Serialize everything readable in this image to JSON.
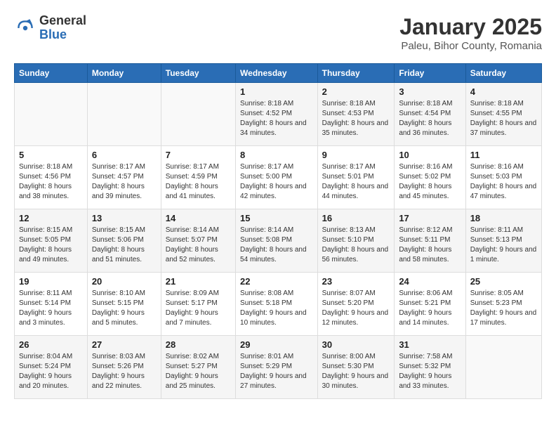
{
  "logo": {
    "general": "General",
    "blue": "Blue"
  },
  "title": "January 2025",
  "subtitle": "Paleu, Bihor County, Romania",
  "weekdays": [
    "Sunday",
    "Monday",
    "Tuesday",
    "Wednesday",
    "Thursday",
    "Friday",
    "Saturday"
  ],
  "weeks": [
    [
      {
        "day": "",
        "sunrise": "",
        "sunset": "",
        "daylight": ""
      },
      {
        "day": "",
        "sunrise": "",
        "sunset": "",
        "daylight": ""
      },
      {
        "day": "",
        "sunrise": "",
        "sunset": "",
        "daylight": ""
      },
      {
        "day": "1",
        "sunrise": "Sunrise: 8:18 AM",
        "sunset": "Sunset: 4:52 PM",
        "daylight": "Daylight: 8 hours and 34 minutes."
      },
      {
        "day": "2",
        "sunrise": "Sunrise: 8:18 AM",
        "sunset": "Sunset: 4:53 PM",
        "daylight": "Daylight: 8 hours and 35 minutes."
      },
      {
        "day": "3",
        "sunrise": "Sunrise: 8:18 AM",
        "sunset": "Sunset: 4:54 PM",
        "daylight": "Daylight: 8 hours and 36 minutes."
      },
      {
        "day": "4",
        "sunrise": "Sunrise: 8:18 AM",
        "sunset": "Sunset: 4:55 PM",
        "daylight": "Daylight: 8 hours and 37 minutes."
      }
    ],
    [
      {
        "day": "5",
        "sunrise": "Sunrise: 8:18 AM",
        "sunset": "Sunset: 4:56 PM",
        "daylight": "Daylight: 8 hours and 38 minutes."
      },
      {
        "day": "6",
        "sunrise": "Sunrise: 8:17 AM",
        "sunset": "Sunset: 4:57 PM",
        "daylight": "Daylight: 8 hours and 39 minutes."
      },
      {
        "day": "7",
        "sunrise": "Sunrise: 8:17 AM",
        "sunset": "Sunset: 4:59 PM",
        "daylight": "Daylight: 8 hours and 41 minutes."
      },
      {
        "day": "8",
        "sunrise": "Sunrise: 8:17 AM",
        "sunset": "Sunset: 5:00 PM",
        "daylight": "Daylight: 8 hours and 42 minutes."
      },
      {
        "day": "9",
        "sunrise": "Sunrise: 8:17 AM",
        "sunset": "Sunset: 5:01 PM",
        "daylight": "Daylight: 8 hours and 44 minutes."
      },
      {
        "day": "10",
        "sunrise": "Sunrise: 8:16 AM",
        "sunset": "Sunset: 5:02 PM",
        "daylight": "Daylight: 8 hours and 45 minutes."
      },
      {
        "day": "11",
        "sunrise": "Sunrise: 8:16 AM",
        "sunset": "Sunset: 5:03 PM",
        "daylight": "Daylight: 8 hours and 47 minutes."
      }
    ],
    [
      {
        "day": "12",
        "sunrise": "Sunrise: 8:15 AM",
        "sunset": "Sunset: 5:05 PM",
        "daylight": "Daylight: 8 hours and 49 minutes."
      },
      {
        "day": "13",
        "sunrise": "Sunrise: 8:15 AM",
        "sunset": "Sunset: 5:06 PM",
        "daylight": "Daylight: 8 hours and 51 minutes."
      },
      {
        "day": "14",
        "sunrise": "Sunrise: 8:14 AM",
        "sunset": "Sunset: 5:07 PM",
        "daylight": "Daylight: 8 hours and 52 minutes."
      },
      {
        "day": "15",
        "sunrise": "Sunrise: 8:14 AM",
        "sunset": "Sunset: 5:08 PM",
        "daylight": "Daylight: 8 hours and 54 minutes."
      },
      {
        "day": "16",
        "sunrise": "Sunrise: 8:13 AM",
        "sunset": "Sunset: 5:10 PM",
        "daylight": "Daylight: 8 hours and 56 minutes."
      },
      {
        "day": "17",
        "sunrise": "Sunrise: 8:12 AM",
        "sunset": "Sunset: 5:11 PM",
        "daylight": "Daylight: 8 hours and 58 minutes."
      },
      {
        "day": "18",
        "sunrise": "Sunrise: 8:11 AM",
        "sunset": "Sunset: 5:13 PM",
        "daylight": "Daylight: 9 hours and 1 minute."
      }
    ],
    [
      {
        "day": "19",
        "sunrise": "Sunrise: 8:11 AM",
        "sunset": "Sunset: 5:14 PM",
        "daylight": "Daylight: 9 hours and 3 minutes."
      },
      {
        "day": "20",
        "sunrise": "Sunrise: 8:10 AM",
        "sunset": "Sunset: 5:15 PM",
        "daylight": "Daylight: 9 hours and 5 minutes."
      },
      {
        "day": "21",
        "sunrise": "Sunrise: 8:09 AM",
        "sunset": "Sunset: 5:17 PM",
        "daylight": "Daylight: 9 hours and 7 minutes."
      },
      {
        "day": "22",
        "sunrise": "Sunrise: 8:08 AM",
        "sunset": "Sunset: 5:18 PM",
        "daylight": "Daylight: 9 hours and 10 minutes."
      },
      {
        "day": "23",
        "sunrise": "Sunrise: 8:07 AM",
        "sunset": "Sunset: 5:20 PM",
        "daylight": "Daylight: 9 hours and 12 minutes."
      },
      {
        "day": "24",
        "sunrise": "Sunrise: 8:06 AM",
        "sunset": "Sunset: 5:21 PM",
        "daylight": "Daylight: 9 hours and 14 minutes."
      },
      {
        "day": "25",
        "sunrise": "Sunrise: 8:05 AM",
        "sunset": "Sunset: 5:23 PM",
        "daylight": "Daylight: 9 hours and 17 minutes."
      }
    ],
    [
      {
        "day": "26",
        "sunrise": "Sunrise: 8:04 AM",
        "sunset": "Sunset: 5:24 PM",
        "daylight": "Daylight: 9 hours and 20 minutes."
      },
      {
        "day": "27",
        "sunrise": "Sunrise: 8:03 AM",
        "sunset": "Sunset: 5:26 PM",
        "daylight": "Daylight: 9 hours and 22 minutes."
      },
      {
        "day": "28",
        "sunrise": "Sunrise: 8:02 AM",
        "sunset": "Sunset: 5:27 PM",
        "daylight": "Daylight: 9 hours and 25 minutes."
      },
      {
        "day": "29",
        "sunrise": "Sunrise: 8:01 AM",
        "sunset": "Sunset: 5:29 PM",
        "daylight": "Daylight: 9 hours and 27 minutes."
      },
      {
        "day": "30",
        "sunrise": "Sunrise: 8:00 AM",
        "sunset": "Sunset: 5:30 PM",
        "daylight": "Daylight: 9 hours and 30 minutes."
      },
      {
        "day": "31",
        "sunrise": "Sunrise: 7:58 AM",
        "sunset": "Sunset: 5:32 PM",
        "daylight": "Daylight: 9 hours and 33 minutes."
      },
      {
        "day": "",
        "sunrise": "",
        "sunset": "",
        "daylight": ""
      }
    ]
  ]
}
